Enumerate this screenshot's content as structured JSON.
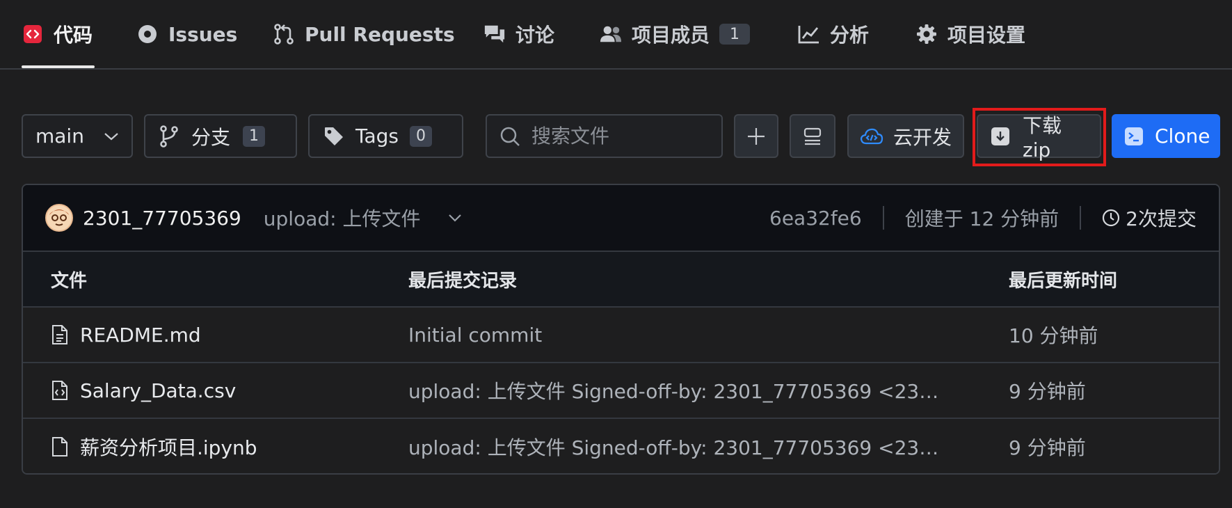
{
  "tabs": [
    {
      "label": "代码",
      "icon": "code-icon",
      "active": true
    },
    {
      "label": "Issues",
      "icon": "issue-circle-icon"
    },
    {
      "label": "Pull Requests",
      "icon": "pull-request-icon"
    },
    {
      "label": "讨论",
      "icon": "discussion-icon"
    },
    {
      "label": "项目成员",
      "icon": "members-icon",
      "badge": "1"
    },
    {
      "label": "分析",
      "icon": "chart-icon"
    },
    {
      "label": "项目设置",
      "icon": "gear-icon"
    }
  ],
  "toolbar": {
    "branch": "main",
    "branches_label": "分支",
    "branches_count": "1",
    "tags_label": "Tags",
    "tags_count": "0",
    "search_placeholder": "搜索文件",
    "cloud_dev_label": "云开发",
    "download_zip_label": "下载zip",
    "clone_label": "Clone"
  },
  "colors": {
    "background": "#1e1e1f",
    "accent_blue": "#1e6cf5",
    "highlight_red": "#e21b1b",
    "code_icon_red": "#e5263c"
  },
  "commit": {
    "author": "2301_77705369",
    "message": "upload: 上传文件",
    "hash": "6ea32fe6",
    "created": "创建于 12 分钟前",
    "commit_count": "2次提交"
  },
  "table": {
    "headers": [
      "文件",
      "最后提交记录",
      "最后更新时间"
    ],
    "rows": [
      {
        "name": "README.md",
        "icon": "document-icon",
        "message": "Initial commit",
        "time": "10 分钟前"
      },
      {
        "name": "Salary_Data.csv",
        "icon": "code-file-icon",
        "message": "upload: 上传文件 Signed-off-by: 2301_77705369 <2301_...",
        "time": "9 分钟前"
      },
      {
        "name": "薪资分析项目.ipynb",
        "icon": "file-icon",
        "message": "upload: 上传文件 Signed-off-by: 2301_77705369 <2301_...",
        "time": "9 分钟前"
      }
    ]
  }
}
